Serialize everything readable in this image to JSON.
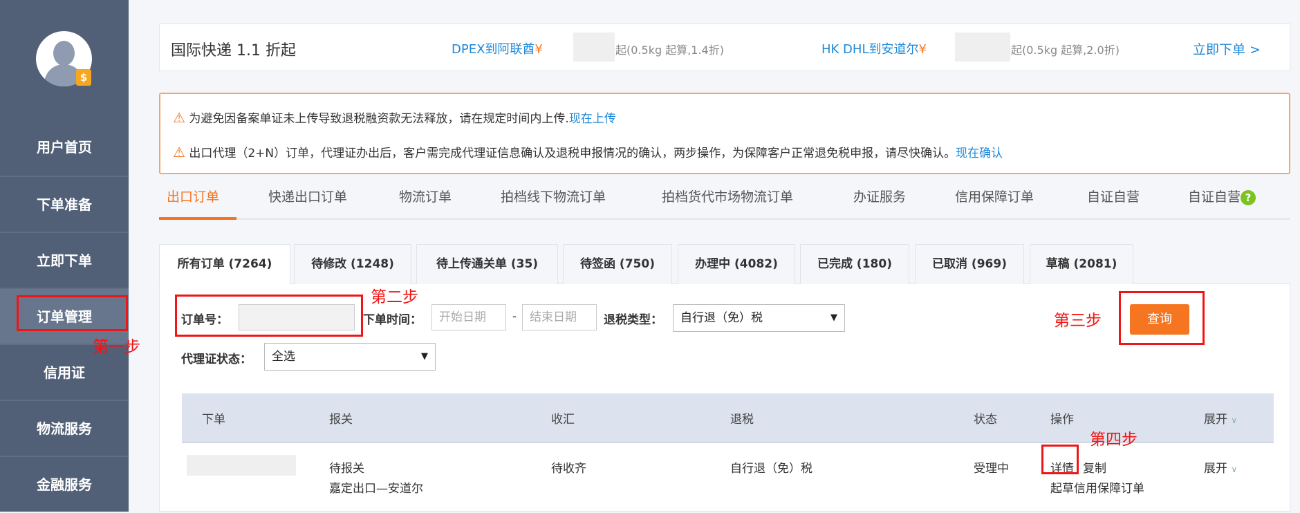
{
  "sidebar": {
    "badge": "$",
    "items": [
      {
        "label": "用户首页"
      },
      {
        "label": "下单准备"
      },
      {
        "label": "立即下单"
      },
      {
        "label": "订单管理"
      },
      {
        "label": "信用证"
      },
      {
        "label": "物流服务"
      },
      {
        "label": "金融服务"
      }
    ],
    "active_index": 3
  },
  "banner": {
    "title": "国际快递 1.1 折起",
    "offers": [
      {
        "route": "DPEX到阿联酋",
        "currency": "¥",
        "note": "起(0.5kg 起算,1.4折)"
      },
      {
        "route": "HK DHL到安道尔",
        "currency": "¥",
        "note": "起(0.5kg 起算,2.0折)"
      }
    ],
    "cta": "立即下单 >"
  },
  "alerts": [
    {
      "text": "为避免因备案单证未上传导致退税融资款无法释放，请在规定时间内上传.",
      "link": "现在上传"
    },
    {
      "text": "出口代理（2+N）订单，代理证办出后，客户需完成代理证信息确认及退税申报情况的确认，两步操作，为保障客户正常退免税申报，请尽快确认。",
      "link": "现在确认"
    }
  ],
  "main_tabs": [
    "出口订单",
    "快递出口订单",
    "物流订单",
    "拍档线下物流订单",
    "拍档货代市场物流订单",
    "办证服务",
    "信用保障订单",
    "自证自营",
    "自证自营"
  ],
  "help_icon": "?",
  "sub_tabs": [
    "所有订单 (7264)",
    "待修改 (1248)",
    "待上传通关单 (35)",
    "待签函 (750)",
    "办理中 (4082)",
    "已完成 (180)",
    "已取消 (969)",
    "草稿 (2081)"
  ],
  "filters": {
    "order_no_label": "订单号：",
    "order_no_value": "",
    "date_label": "下单时间：",
    "start_placeholder": "开始日期",
    "date_sep": "-",
    "end_placeholder": "结束日期",
    "tax_type_label": "退税类型：",
    "tax_type_value": "自行退（免）税",
    "proxy_status_label": "代理证状态：",
    "proxy_status_value": "全选",
    "query_button": "查询"
  },
  "annotations": {
    "step1": "第一步",
    "step2": "第二步",
    "step3": "第三步",
    "step4": "第四步"
  },
  "table": {
    "headers": [
      "下单",
      "报关",
      "收汇",
      "退税",
      "状态",
      "操作",
      "展开"
    ],
    "rows": [
      {
        "customs_status": "待报关",
        "customs_route": "嘉定出口—安道尔",
        "remittance": "待收齐",
        "tax_refund": "自行退（免）税",
        "status": "受理中",
        "action_detail": "详情",
        "action_sep": "|",
        "action_copy": "复制",
        "action_draft": "起草信用保障订单",
        "expand": "展开"
      }
    ]
  },
  "colors": {
    "sidebar": "#515f77",
    "accent": "#f57520",
    "link": "#1e88d8",
    "annotation": "#f01414"
  }
}
